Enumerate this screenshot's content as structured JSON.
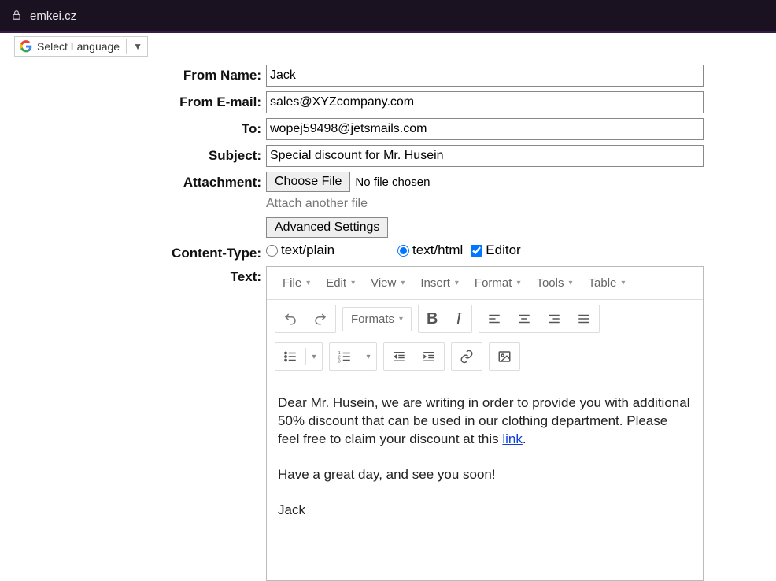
{
  "url_bar": {
    "host": "emkei.cz"
  },
  "lang": {
    "label": "Select Language"
  },
  "form": {
    "from_name": {
      "label": "From Name:",
      "value": "Jack"
    },
    "from_email": {
      "label": "From E-mail:",
      "value": "sales@XYZcompany.com"
    },
    "to": {
      "label": "To:",
      "value": "wopej59498@jetsmails.com"
    },
    "subject": {
      "label": "Subject:",
      "value": "Special discount for Mr. Husein"
    },
    "attachment": {
      "label": "Attachment:",
      "choose_btn": "Choose File",
      "no_file": "No file chosen",
      "another": "Attach another file",
      "advanced": "Advanced Settings"
    },
    "content_type": {
      "label": "Content-Type:",
      "plain": "text/plain",
      "html": "text/html",
      "editor": "Editor"
    },
    "text_label": "Text:"
  },
  "editor": {
    "menus": {
      "file": "File",
      "edit": "Edit",
      "view": "View",
      "insert": "Insert",
      "format": "Format",
      "tools": "Tools",
      "table": "Table"
    },
    "formats_btn": "Formats"
  },
  "body": {
    "para1_pre": "Dear Mr. Husein, we are writing in order to provide you with additional 50% discount that can be used in our clothing department. Please feel free to claim your discount at this ",
    "link_text": "link",
    "para1_post": ".",
    "para2": "Have a great day, and see you soon!",
    "para3": "Jack"
  }
}
